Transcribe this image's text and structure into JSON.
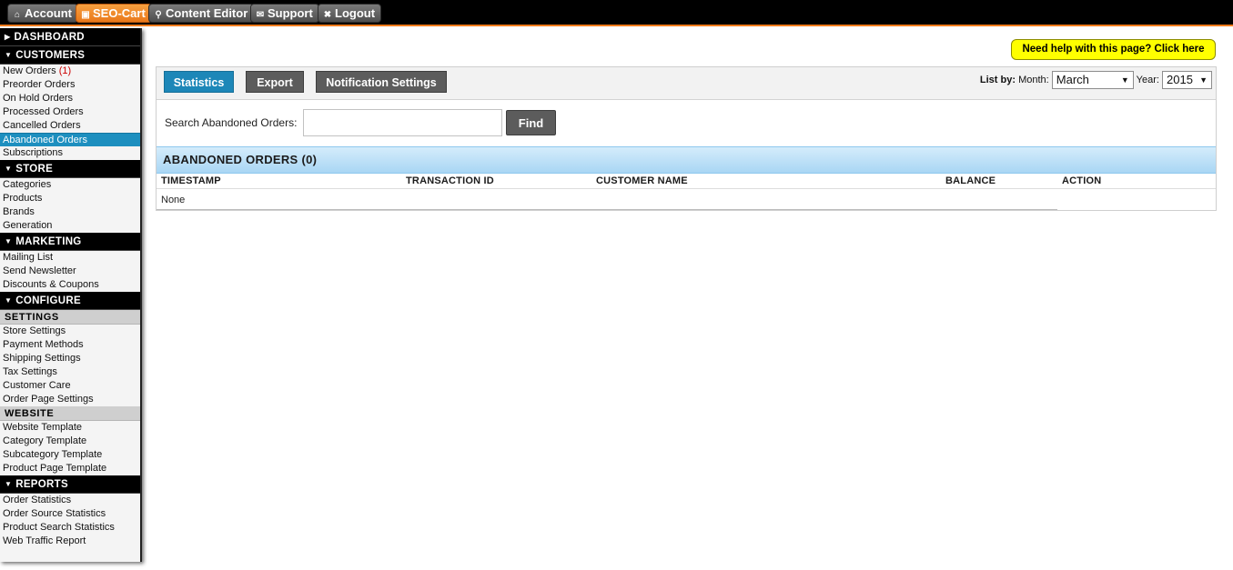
{
  "topbar": {
    "items": [
      {
        "label": "Account",
        "icon": "home-icon"
      },
      {
        "label": "SEO-Cart",
        "icon": "cart-icon"
      },
      {
        "label": "Content Editor",
        "icon": "wrench-icon"
      },
      {
        "label": "Support",
        "icon": "support-icon"
      },
      {
        "label": "Logout",
        "icon": "close-icon"
      }
    ]
  },
  "sidebar": {
    "dashboard": "DASHBOARD",
    "customers": {
      "title": "CUSTOMERS",
      "new_orders": "New Orders",
      "new_orders_count": "(1)",
      "items": [
        "Preorder Orders",
        "On Hold Orders",
        "Processed Orders",
        "Cancelled Orders",
        "Abandoned Orders",
        "Subscriptions"
      ]
    },
    "store": {
      "title": "STORE",
      "items": [
        "Categories",
        "Products",
        "Brands",
        "Generation"
      ]
    },
    "marketing": {
      "title": "MARKETING",
      "items": [
        "Mailing List",
        "Send Newsletter",
        "Discounts & Coupons"
      ]
    },
    "configure": {
      "title": "CONFIGURE",
      "settings_title": "SETTINGS",
      "settings": [
        "Store Settings",
        "Payment Methods",
        "Shipping Settings",
        "Tax Settings",
        "Customer Care",
        "Order Page Settings"
      ],
      "website_title": "WEBSITE",
      "website": [
        "Website Template",
        "Category Template",
        "Subcategory Template",
        "Product Page Template"
      ]
    },
    "reports": {
      "title": "REPORTS",
      "items": [
        "Order Statistics",
        "Order Source Statistics",
        "Product Search Statistics",
        "Web Traffic Report"
      ]
    }
  },
  "help_button": "Need help with this page? Click here",
  "toolbar": {
    "statistics": "Statistics",
    "export": "Export",
    "notification_settings": "Notification Settings",
    "list_by": "List by:",
    "month_label": "Month:",
    "month_value": "March",
    "year_label": "Year:",
    "year_value": "2015"
  },
  "search": {
    "label": "Search Abandoned Orders:",
    "value": "",
    "placeholder": "",
    "find": "Find"
  },
  "orders": {
    "title": "ABANDONED ORDERS (0)",
    "columns": [
      "TIMESTAMP",
      "TRANSACTION ID",
      "CUSTOMER NAME",
      "BALANCE",
      "ACTION"
    ],
    "empty_text": "None"
  },
  "colors": {
    "accent": "#1d87b8",
    "brand_orange": "#f07b1b",
    "help_yellow": "#ffff00"
  }
}
